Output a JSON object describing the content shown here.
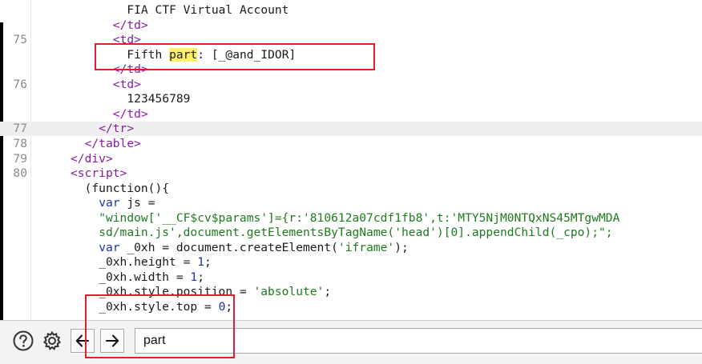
{
  "code_lines": [
    {
      "ln": "",
      "indent": 17,
      "tokens": [
        {
          "t": "FIA CTF Virtual Account",
          "c": "txt"
        }
      ]
    },
    {
      "ln": "",
      "indent": 15,
      "tokens": [
        {
          "t": "</",
          "c": "tag"
        },
        {
          "t": "td",
          "c": "tag"
        },
        {
          "t": ">",
          "c": "tag"
        }
      ]
    },
    {
      "ln": "75",
      "indent": 15,
      "tokens": [
        {
          "t": "<",
          "c": "tag"
        },
        {
          "t": "td",
          "c": "tag"
        },
        {
          "t": ">",
          "c": "tag"
        }
      ]
    },
    {
      "ln": "",
      "indent": 17,
      "tokens": [
        {
          "t": "Fifth ",
          "c": "txt"
        },
        {
          "t": "part",
          "c": "hit"
        },
        {
          "t": ": [_@and_IDOR]",
          "c": "txt"
        }
      ]
    },
    {
      "ln": "",
      "indent": 15,
      "tokens": [
        {
          "t": "</",
          "c": "tag"
        },
        {
          "t": "td",
          "c": "tag"
        },
        {
          "t": ">",
          "c": "tag"
        }
      ]
    },
    {
      "ln": "76",
      "indent": 15,
      "tokens": [
        {
          "t": "<",
          "c": "tag"
        },
        {
          "t": "td",
          "c": "tag"
        },
        {
          "t": ">",
          "c": "tag"
        }
      ]
    },
    {
      "ln": "",
      "indent": 17,
      "tokens": [
        {
          "t": "123456789",
          "c": "txt"
        }
      ]
    },
    {
      "ln": "",
      "indent": 15,
      "tokens": [
        {
          "t": "</",
          "c": "tag"
        },
        {
          "t": "td",
          "c": "tag"
        },
        {
          "t": ">",
          "c": "tag"
        }
      ]
    },
    {
      "ln": "77",
      "indent": 13,
      "hl": true,
      "tokens": [
        {
          "t": "</",
          "c": "tag"
        },
        {
          "t": "tr",
          "c": "tag"
        },
        {
          "t": ">",
          "c": "tag"
        }
      ]
    },
    {
      "ln": "78",
      "indent": 11,
      "tokens": [
        {
          "t": "</",
          "c": "tag"
        },
        {
          "t": "table",
          "c": "tag"
        },
        {
          "t": ">",
          "c": "tag"
        }
      ]
    },
    {
      "ln": "79",
      "indent": 9,
      "tokens": [
        {
          "t": "</",
          "c": "tag"
        },
        {
          "t": "div",
          "c": "tag"
        },
        {
          "t": ">",
          "c": "tag"
        }
      ]
    },
    {
      "ln": "80",
      "indent": 9,
      "tokens": [
        {
          "t": "<",
          "c": "tag"
        },
        {
          "t": "script",
          "c": "tag"
        },
        {
          "t": ">",
          "c": "tag"
        }
      ]
    },
    {
      "ln": "",
      "indent": 11,
      "tokens": [
        {
          "t": "(function(){",
          "c": "txt"
        }
      ]
    },
    {
      "ln": "",
      "indent": 13,
      "tokens": [
        {
          "t": "var",
          "c": "kw"
        },
        {
          "t": " js =",
          "c": "txt"
        }
      ]
    },
    {
      "ln": "",
      "indent": 13,
      "tokens": [
        {
          "t": "\"window['__CF$cv$params']={r:'810612a07cdf1fb8',t:'MTY5NjM0NTQxNS45MTgwMDA",
          "c": "str"
        }
      ]
    },
    {
      "ln": "",
      "indent": 13,
      "tokens": [
        {
          "t": "sd/main.js',document.getElementsByTagName('head')[0].appendChild(_cpo);\";",
          "c": "str"
        }
      ]
    },
    {
      "ln": "",
      "indent": 13,
      "tokens": [
        {
          "t": "var",
          "c": "kw"
        },
        {
          "t": " _0xh = document.createElement(",
          "c": "txt"
        },
        {
          "t": "'iframe'",
          "c": "str"
        },
        {
          "t": ");",
          "c": "txt"
        }
      ]
    },
    {
      "ln": "",
      "indent": 13,
      "tokens": [
        {
          "t": "_0xh.height = ",
          "c": "txt"
        },
        {
          "t": "1",
          "c": "num"
        },
        {
          "t": ";",
          "c": "txt"
        }
      ]
    },
    {
      "ln": "",
      "indent": 13,
      "tokens": [
        {
          "t": "_0xh.width = ",
          "c": "txt"
        },
        {
          "t": "1",
          "c": "num"
        },
        {
          "t": ";",
          "c": "txt"
        }
      ]
    },
    {
      "ln": "",
      "indent": 13,
      "tokens": [
        {
          "t": "_0xh.style.position = ",
          "c": "txt"
        },
        {
          "t": "'absolute'",
          "c": "str"
        },
        {
          "t": ";",
          "c": "txt"
        }
      ]
    },
    {
      "ln": "",
      "indent": 13,
      "tokens": [
        {
          "t": "_0xh.style.top = ",
          "c": "txt"
        },
        {
          "t": "0",
          "c": "num"
        },
        {
          "t": ";",
          "c": "txt"
        }
      ]
    }
  ],
  "find_bar": {
    "search_value": "part",
    "help_icon": "help-circle-icon",
    "settings_icon": "gear-icon",
    "prev_icon": "arrow-left-icon",
    "next_icon": "arrow-right-icon"
  },
  "colors": {
    "tag": "#8a1aa3",
    "string": "#1f7a1f",
    "keyword": "#1c2fb0",
    "search_highlight": "#fff06a",
    "annotation_box": "#e0202a",
    "current_line": "#efefef"
  }
}
